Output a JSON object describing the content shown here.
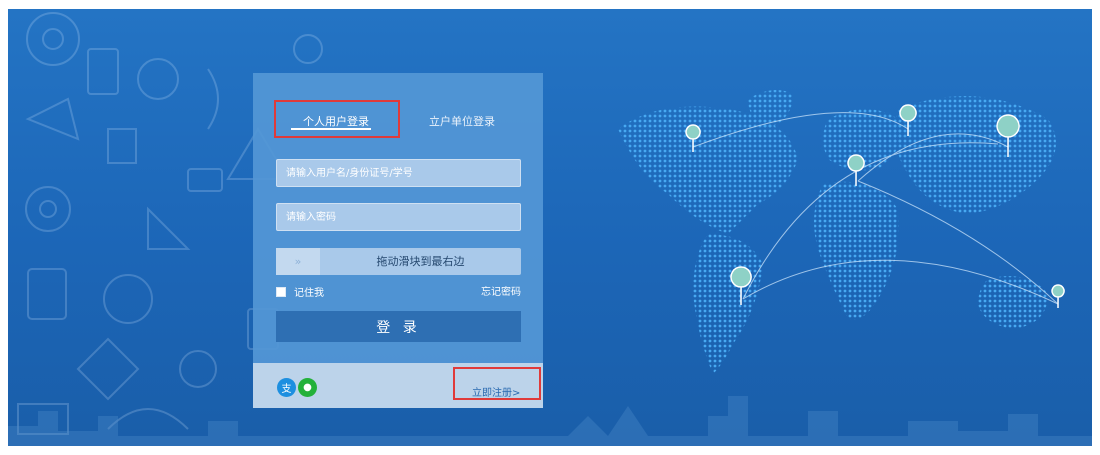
{
  "login": {
    "tabs": [
      {
        "label": "个人用户登录",
        "active": true
      },
      {
        "label": "立户单位登录",
        "active": false
      }
    ],
    "username_placeholder": "请输入用户名/身份证号/学号",
    "password_placeholder": "请输入密码",
    "slider": {
      "handle_glyph": "»",
      "text": "拖动滑块到最右边"
    },
    "remember_label": "记住我",
    "forgot_label": "忘记密码",
    "submit_label": "登 录",
    "register_label": "立即注册>",
    "social": [
      {
        "icon": "alipay-icon",
        "glyph": "支",
        "color": "#1d8fe0"
      },
      {
        "icon": "wechat-icon",
        "glyph": "●",
        "color": "#23b13a"
      }
    ]
  },
  "colors": {
    "background": "#1f6cbd",
    "card": "#5497d6",
    "input": "#a9c9ea",
    "button": "#2e6fb3",
    "highlight": "#e03a3a",
    "map_pin": "#8ed1c6"
  }
}
